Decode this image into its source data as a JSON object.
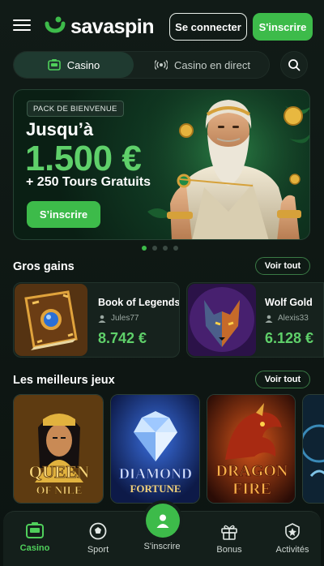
{
  "header": {
    "brand": "savaspin",
    "login_label": "Se connecter",
    "signup_label": "S'inscrire"
  },
  "tabs": [
    {
      "label": "Casino",
      "icon": "slot-machine-icon",
      "active": true
    },
    {
      "label": "Casino en direct",
      "icon": "live-broadcast-icon",
      "active": false
    }
  ],
  "hero": {
    "badge": "PACK DE BIENVENUE",
    "title": "Jusqu’à",
    "amount": "1.500 €",
    "subtitle": "+ 250 Tours Gratuits",
    "cta": "S’inscrire",
    "slides": 4,
    "active_slide": 1
  },
  "big_wins": {
    "title": "Gros gains",
    "see_all": "Voir tout",
    "items": [
      {
        "game": "Book of Legends",
        "user": "Jules77",
        "amount": "8.742 €"
      },
      {
        "game": "Wolf Gold",
        "user": "Alexis33",
        "amount": "6.128 €"
      }
    ]
  },
  "top_games": {
    "title": "Les meilleurs jeux",
    "see_all": "Voir tout",
    "items": [
      {
        "title_line1": "QUEEN",
        "title_line2": "OF NILE"
      },
      {
        "title_line1": "DIAMOND",
        "title_line2": "FORTUNE"
      },
      {
        "title_line1": "DRAGON",
        "title_line2": "FIRE"
      }
    ]
  },
  "bottom_nav": [
    {
      "label": "Casino",
      "icon": "slot-machine-icon",
      "active": true
    },
    {
      "label": "Sport",
      "icon": "soccer-ball-icon",
      "active": false
    },
    {
      "label": "S'inscrire",
      "icon": "user-icon",
      "active": false
    },
    {
      "label": "Bonus",
      "icon": "gift-icon",
      "active": false
    },
    {
      "label": "Activités",
      "icon": "badge-icon",
      "active": false
    }
  ],
  "colors": {
    "accent": "#3dbb4a",
    "accent_text": "#5fd06a",
    "background": "#0d1512"
  }
}
